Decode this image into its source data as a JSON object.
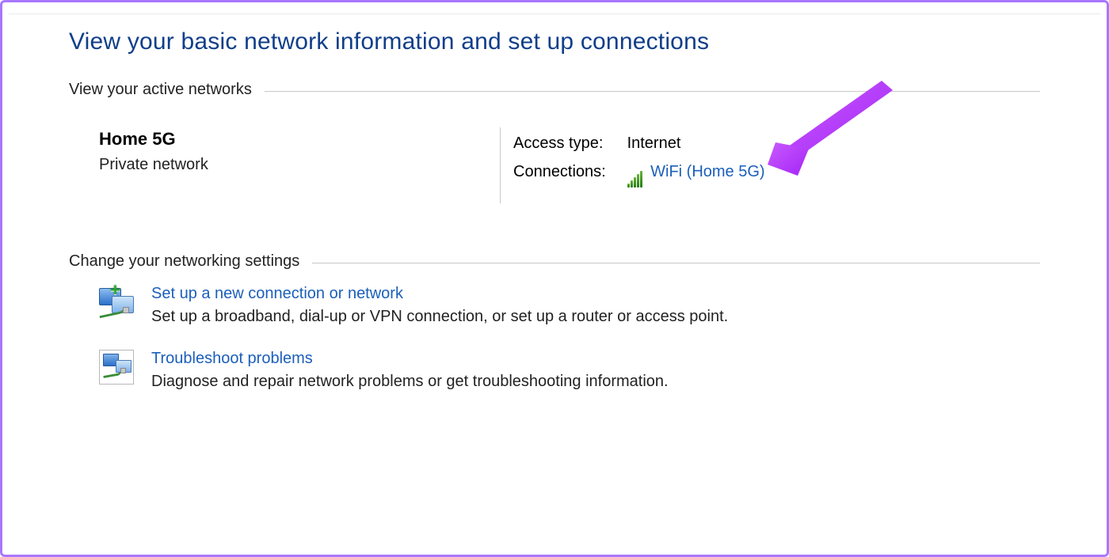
{
  "pageTitle": "View your basic network information and set up connections",
  "sections": {
    "activeHeading": "View your active networks",
    "changeHeading": "Change your networking settings"
  },
  "network": {
    "name": "Home 5G",
    "category": "Private network",
    "accessTypeLabel": "Access type:",
    "accessTypeValue": "Internet",
    "connectionsLabel": "Connections:",
    "connectionLinkText": "WiFi (Home 5G)"
  },
  "options": {
    "setup": {
      "title": "Set up a new connection or network",
      "desc": "Set up a broadband, dial-up or VPN connection, or set up a router or access point."
    },
    "troubleshoot": {
      "title": "Troubleshoot problems",
      "desc": "Diagnose and repair network problems or get troubleshooting information."
    }
  },
  "colors": {
    "heading": "#103e8a",
    "link": "#1b5fbb",
    "annotation": "#b73cff"
  }
}
